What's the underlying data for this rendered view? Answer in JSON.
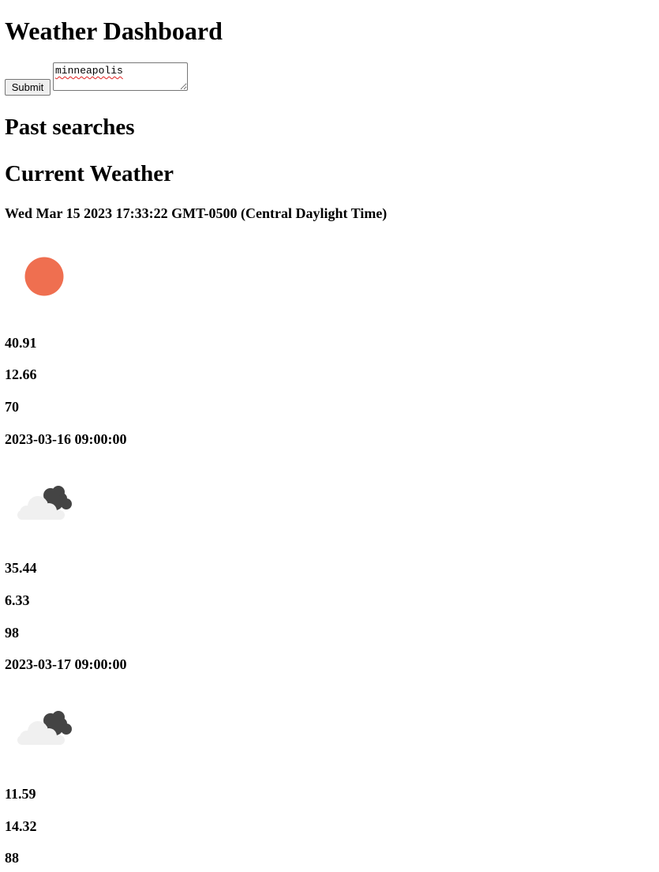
{
  "header": {
    "title": "Weather Dashboard"
  },
  "search": {
    "submit_label": "Submit",
    "city_value": "minneapolis"
  },
  "past_searches": {
    "title": "Past searches"
  },
  "current": {
    "title": "Current Weather",
    "datetime": "Wed Mar 15 2023 17:33:22 GMT-0500 (Central Daylight Time)",
    "icon": "sun-icon",
    "icon_color": "#ef6f50",
    "temp": "40.91",
    "wind": "12.66",
    "humidity": "70"
  },
  "forecast": [
    {
      "datetime": "2023-03-16 09:00:00",
      "icon": "cloudy-icon",
      "temp": "35.44",
      "wind": "6.33",
      "humidity": "98"
    },
    {
      "datetime": "2023-03-17 09:00:00",
      "icon": "cloudy-icon",
      "temp": "11.59",
      "wind": "14.32",
      "humidity": "88"
    }
  ]
}
